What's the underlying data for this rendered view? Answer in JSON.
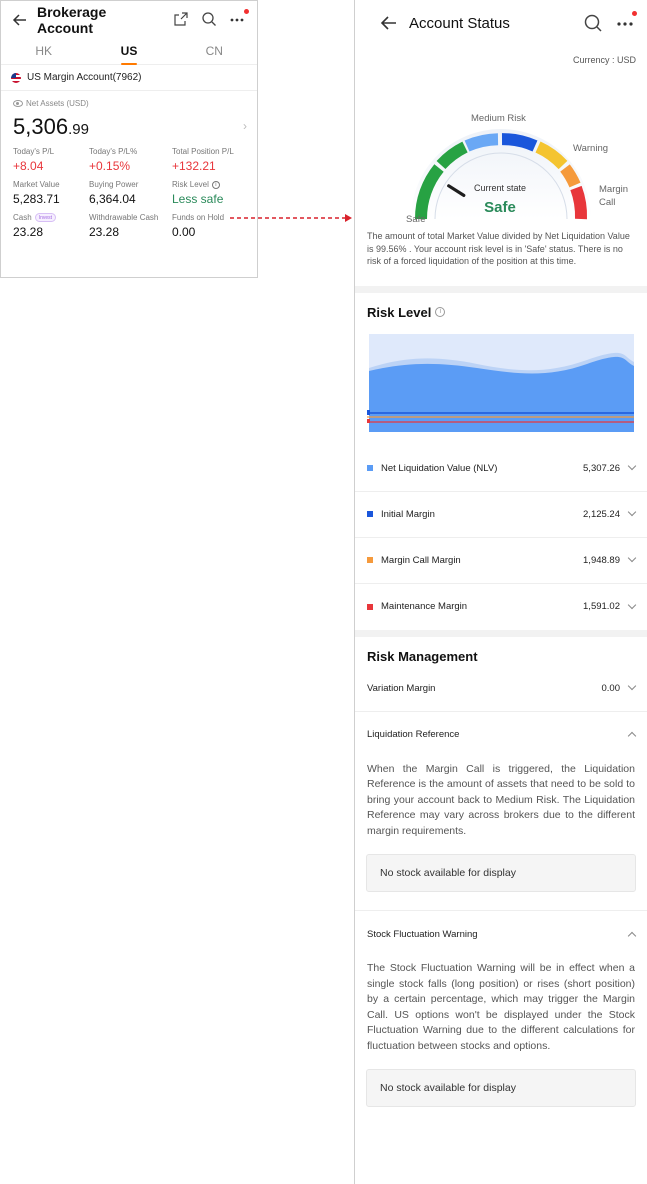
{
  "left": {
    "title": "Brokerage Account",
    "tabs": [
      "HK",
      "US",
      "CN"
    ],
    "active_tab": "US",
    "account": "US Margin Account(7962)",
    "net_assets_label": "Net Assets (USD)",
    "net_assets_int": "5,306",
    "net_assets_dec": ".99",
    "stats": [
      {
        "label": "Today's P/L",
        "value": "+8.04",
        "tone": "red"
      },
      {
        "label": "Today's P/L%",
        "value": "+0.15%",
        "tone": "red"
      },
      {
        "label": "Total Position P/L",
        "value": "+132.21",
        "tone": "red"
      },
      {
        "label": "Market Value",
        "value": "5,283.71",
        "tone": "plain"
      },
      {
        "label": "Buying Power",
        "value": "6,364.04",
        "tone": "plain"
      },
      {
        "label": "Risk Level",
        "value": "Less safe",
        "tone": "green"
      },
      {
        "label": "Cash",
        "value": "23.28",
        "tone": "plain"
      },
      {
        "label": "Withdrawable Cash",
        "value": "23.28",
        "tone": "plain"
      },
      {
        "label": "Funds on Hold",
        "value": "0.00",
        "tone": "plain"
      }
    ],
    "invest_badge": "Invest",
    "info_glyph": "i"
  },
  "right": {
    "title": "Account Status",
    "currency": "Currency : USD",
    "gauge": {
      "labels": {
        "safe": "Safe",
        "medium": "Medium Risk",
        "warning": "Warning",
        "margin_call_1": "Margin",
        "margin_call_2": "Call"
      },
      "current_state_label": "Current state",
      "current_state": "Safe",
      "needle_level": 0.18
    },
    "description": "The amount of total Market Value divided by Net Liquidation Value is 99.56% . Your account risk level is in 'Safe' status. There is no risk of a forced liquidation of the position at this time.",
    "risk_level_title": "Risk Level",
    "metrics": [
      {
        "label": "Net Liquidation Value (NLV)",
        "value": "5,307.26",
        "color": "#5b9cf5"
      },
      {
        "label": "Initial Margin",
        "value": "2,125.24",
        "color": "#1a56db"
      },
      {
        "label": "Margin Call Margin",
        "value": "1,948.89",
        "color": "#f59a3c"
      },
      {
        "label": "Maintenance Margin",
        "value": "1,591.02",
        "color": "#e8363b"
      }
    ],
    "risk_management_title": "Risk Management",
    "variation_margin_label": "Variation Margin",
    "variation_margin_value": "0.00",
    "liquidation_ref_label": "Liquidation Reference",
    "liquidation_ref_text": "When the Margin Call is triggered, the Liquidation Reference is the amount of assets that need to be sold to bring your account back to Medium Risk. The Liquidation Reference may vary across brokers due to the different margin requirements.",
    "no_stock_1": "No stock available for display",
    "fluctuation_label": "Stock Fluctuation Warning",
    "fluctuation_text": "The Stock Fluctuation Warning will be in effect when a single stock falls (long position) or rises (short position) by a certain percentage, which may trigger the Margin Call. US options won't be displayed under the Stock Fluctuation Warning due to the different calculations for fluctuation between stocks and options.",
    "no_stock_2": "No stock available for display"
  },
  "colors": {
    "positive": "#e8363b",
    "safe_green": "#2a8a5a",
    "accent_orange": "#ff7a00"
  }
}
